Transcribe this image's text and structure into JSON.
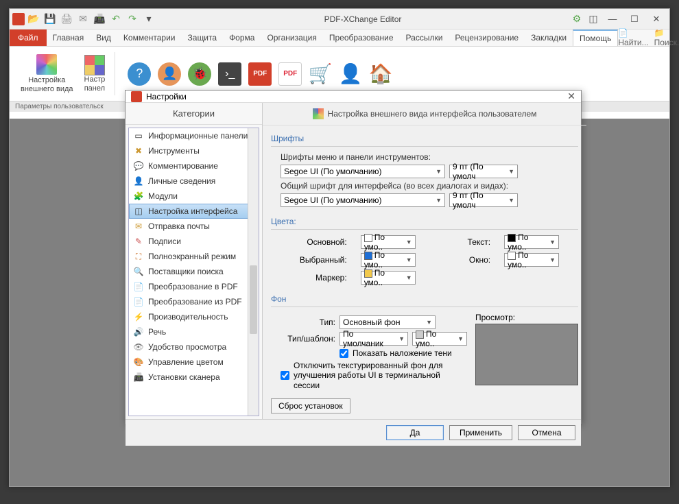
{
  "app": {
    "title": "PDF-XChange Editor"
  },
  "tabs": {
    "file": "Файл",
    "items": [
      "Главная",
      "Вид",
      "Комментарии",
      "Защита",
      "Форма",
      "Организация",
      "Преобразование",
      "Рассылки",
      "Рецензирование",
      "Закладки",
      "Помощь"
    ],
    "active": 10,
    "right": {
      "find": "Найти...",
      "search": "Поиск..."
    }
  },
  "ribbon": {
    "btn1": "Настройка\nвнешнего вида",
    "btn2": "Настр\nпанел"
  },
  "status": "Параметры пользовательск",
  "dialog": {
    "title": "Настройки",
    "categories_header": "Категории",
    "categories": [
      {
        "label": "Информационные панели до",
        "icon": "ℹ"
      },
      {
        "label": "Инструменты",
        "icon": "✖"
      },
      {
        "label": "Комментирование",
        "icon": "💬"
      },
      {
        "label": "Личные сведения",
        "icon": "👤"
      },
      {
        "label": "Модули",
        "icon": "🧩"
      },
      {
        "label": "Настройка интерфейса",
        "icon": "◫",
        "selected": true
      },
      {
        "label": "Отправка почты",
        "icon": "✉"
      },
      {
        "label": "Подписи",
        "icon": "✎"
      },
      {
        "label": "Полноэкранный режим",
        "icon": "⛶"
      },
      {
        "label": "Поставщики поиска",
        "icon": "🔍"
      },
      {
        "label": "Преобразование в PDF",
        "icon": "📄"
      },
      {
        "label": "Преобразование из PDF",
        "icon": "📄"
      },
      {
        "label": "Производительность",
        "icon": "⚡"
      },
      {
        "label": "Речь",
        "icon": "🔊"
      },
      {
        "label": "Удобство просмотра",
        "icon": "👁"
      },
      {
        "label": "Управление цветом",
        "icon": "🎨"
      },
      {
        "label": "Установки сканера",
        "icon": "📠"
      }
    ],
    "right_header": "Настройка внешнего вида интерфейса пользователем",
    "fonts": {
      "title": "Шрифты",
      "menu_label": "Шрифты меню и панели инструментов:",
      "menu_font": "Segoe UI (По умолчанию)",
      "menu_size": "9 пт (По умолч",
      "ui_label": "Общий шрифт для интерфейса (во всех диалогах и видах):",
      "ui_font": "Segoe UI (По умолчанию)",
      "ui_size": "9 пт (По умолч"
    },
    "colors": {
      "title": "Цвета:",
      "main": "Основной:",
      "selected": "Выбранный:",
      "marker": "Маркер:",
      "text": "Текст:",
      "window": "Окно:",
      "default": "По умо.."
    },
    "bg": {
      "title": "Фон",
      "type_label": "Тип:",
      "type_value": "Основный фон",
      "pattern_label": "Тип/шаблон:",
      "pattern_value": "По умолчаник",
      "pattern_color": "По умо..",
      "shadow": "Показать наложение тени",
      "textured": "Отключить текстурированный фон для улучшения работы UI в терминальной сессии",
      "preview": "Просмотр:"
    },
    "reset": "Сброс установок",
    "ok": "Да",
    "apply": "Применить",
    "cancel": "Отмена"
  }
}
